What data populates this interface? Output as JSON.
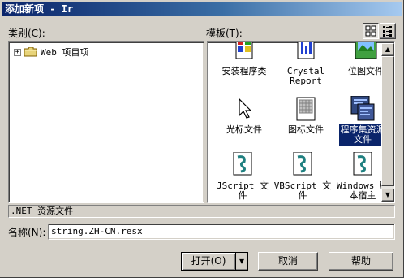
{
  "window": {
    "title": "添加新项 - Ir"
  },
  "categories": {
    "label": "类别(C):",
    "tree": [
      {
        "expander": "+",
        "label": "Web 项目项"
      }
    ]
  },
  "templates": {
    "label": "模板(T):",
    "view_large_icons": "large-icons-view",
    "view_small_icons": "small-icons-view",
    "items": [
      {
        "label": "安装程序类",
        "icon": "installer-class-icon"
      },
      {
        "label": "Crystal\nReport",
        "icon": "crystal-report-icon"
      },
      {
        "label": "位图文件",
        "icon": "bitmap-file-icon"
      },
      {
        "label": "光标文件",
        "icon": "cursor-file-icon"
      },
      {
        "label": "图标文件",
        "icon": "icon-file-icon"
      },
      {
        "label": "程序集资源\n文件",
        "icon": "assembly-resource-icon",
        "selected": true
      },
      {
        "label": "JScript 文\n件",
        "icon": "jscript-file-icon"
      },
      {
        "label": "VBScript 文\n件",
        "icon": "vbscript-file-icon"
      },
      {
        "label": "Windows 脚\n本宿主",
        "icon": "windows-script-host-icon"
      }
    ]
  },
  "description": ".NET 资源文件",
  "name": {
    "label": "名称(N):",
    "value": "string.ZH-CN.resx"
  },
  "buttons": {
    "open": "打开(O)",
    "open_dropdown": "▾",
    "cancel": "取消",
    "help": "帮助"
  },
  "colors": {
    "selection": "#0a246a",
    "face": "#d4d0c8"
  }
}
